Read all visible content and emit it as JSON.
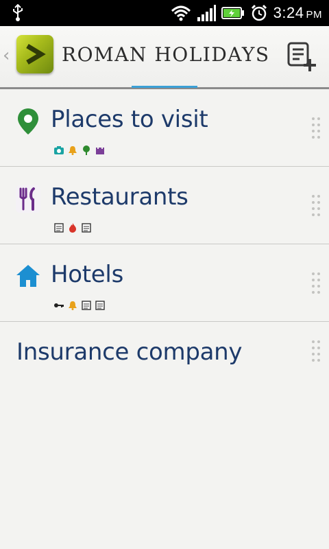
{
  "status_bar": {
    "time": "3:24",
    "ampm": "PM"
  },
  "header": {
    "title": "ROMAN HOLIDAYS"
  },
  "lists": [
    {
      "title": "Places to visit",
      "icon": "map-pin-icon",
      "tags": [
        "camera-tag",
        "bell-tag",
        "tree-tag",
        "castle-tag"
      ]
    },
    {
      "title": "Restaurants",
      "icon": "fork-knife-icon",
      "tags": [
        "note-tag",
        "fire-tag",
        "note-tag"
      ]
    },
    {
      "title": "Hotels",
      "icon": "home-icon",
      "tags": [
        "key-tag",
        "bell-tag",
        "note-tag",
        "note-tag"
      ]
    },
    {
      "title": "Insurance company"
    }
  ],
  "colors": {
    "title_text": "#1d3a6a",
    "tab_indicator": "#3aa0d6",
    "logo_green": "#a8bc1c"
  }
}
